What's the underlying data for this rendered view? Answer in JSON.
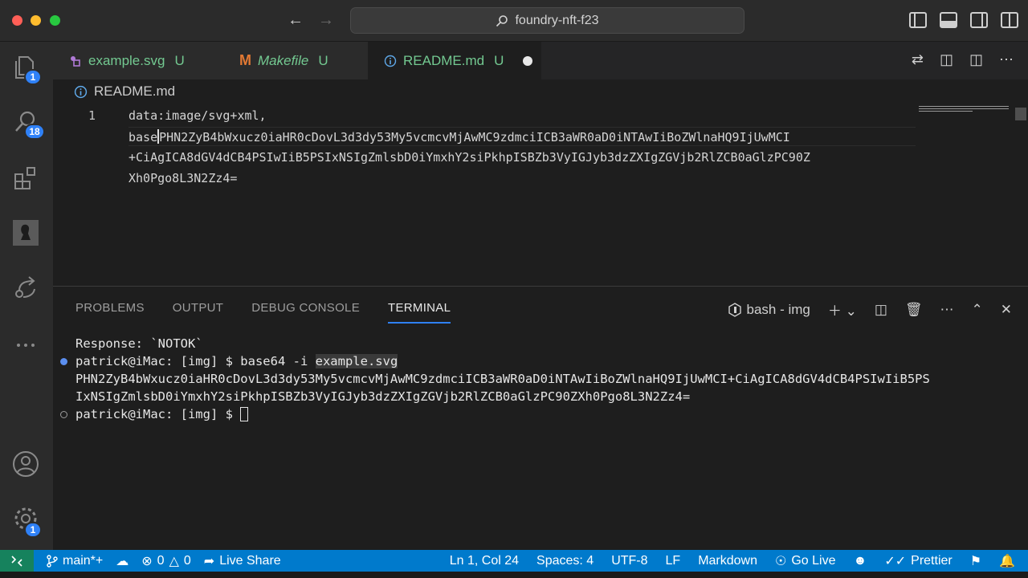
{
  "window": {
    "search_label": "foundry-nft-f23"
  },
  "activity_bar": {
    "explorer_badge": "1",
    "search_badge": "18",
    "settings_badge": "1"
  },
  "tabs": [
    {
      "label": "example.svg",
      "status": "U",
      "icon": "svg-file-icon"
    },
    {
      "label": "Makefile",
      "status": "U",
      "icon": "makefile-m-icon"
    },
    {
      "label": "README.md",
      "status": "U",
      "icon": "info-icon",
      "active": true,
      "dirty": true
    }
  ],
  "breadcrumb": {
    "file": "README.md"
  },
  "editor": {
    "line_number": "1",
    "line_1": "data:image/svg+xml,",
    "wrap_1_before_cursor": "base",
    "wrap_1_after_cursor": "PHN2ZyB4bWxucz0iaHR0cDovL3d3dy53My5vcmcvMjAwMC9zdmciICB3aWR0aD0iNTAwIiBoZWlnaHQ9IjUwMCI",
    "wrap_2": "+CiAgICA8dGV4dCB4PSIwIiB5PSIxNSIgZmlsbD0iYmxhY2siPkhpISBZb3VyIGJyb3dzZXIgZGVjb2RlZCB0aGlzPC90Z",
    "wrap_3": "Xh0Pgo8L3N2Zz4="
  },
  "panel": {
    "tabs": [
      "PROBLEMS",
      "OUTPUT",
      "DEBUG CONSOLE",
      "TERMINAL"
    ],
    "active_tab": "TERMINAL",
    "terminal_name": "bash - img",
    "lines": [
      "Response: `NOTOK`",
      "patrick@iMac: [img] $ base64 -i ",
      "example.svg",
      "PHN2ZyB4bWxucz0iaHR0cDovL3d3dy53My5vcmcvMjAwMC9zdmciICB3aWR0aD0iNTAwIiBoZWlnaHQ9IjUwMCI+CiAgICA8dGV4dCB4PSIwIiB5PSIxNSIgZmlsbD0iYmxhY2siPkhpISBZb3VyIGJyb3dzZXIgZGVjb2RlZCB0aGlzPC90ZXh0Pgo8L3N2Zz4=",
      "patrick@iMac: [img] $ "
    ],
    "output_wrap_1": "PHN2ZyB4bWxucz0iaHR0cDovL3d3dy53My5vcmcvMjAwMC9zdmciICB3aWR0aD0iNTAwIiBoZWlnaHQ9IjUwMCI+CiAgICA8dGV4dCB4PSIwIiB5PSIxNSIgZmlsbD0iYmxhY2siPkhpISBZb3VyIGJyb3dzZXIgZGVjb2RlZCB0aGlzPC90ZXh0Pgo8L3N2Zz4=",
    "output_line_a": "PHN2ZyB4bWxucz0iaHR0cDovL3d3dy53My5vcmcvMjAwMC9zdmciICB3aWR0aD0iNTAwIiBoZWlnaHQ9IjUwMCI+CiAgICA8dGV4dCB4PSIwIiB5PS",
    "output_line_b": "IxNSIgZmlsbD0iYmxhY2siPkhpISBZb3VyIGJyb3dzZXIgZGVjb2RlZCB0aGlzPC90ZXh0Pgo8L3N2Zz4="
  },
  "statusbar": {
    "branch": "main*+",
    "errors": "0",
    "warnings": "0",
    "live_share": "Live Share",
    "position": "Ln 1, Col 24",
    "spaces": "Spaces: 4",
    "encoding": "UTF-8",
    "eol": "LF",
    "language": "Markdown",
    "go_live": "Go Live",
    "prettier": "Prettier"
  },
  "colors": {
    "accent": "#007acc",
    "git_untracked": "#73c991",
    "badge": "#2f81f7",
    "remote": "#16825d"
  }
}
